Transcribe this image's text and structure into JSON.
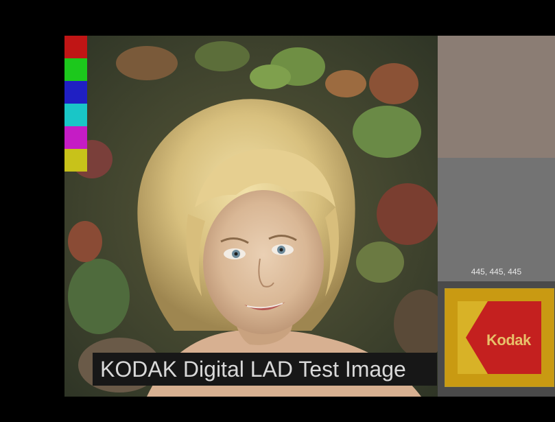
{
  "caption": "KODAK Digital LAD Test Image",
  "patch_readout": "445, 445, 445",
  "logo": {
    "wordmark": "Kodak",
    "colors": {
      "gold": "#c99a12",
      "red": "#c4201f",
      "yellow": "#d8b227"
    }
  },
  "swatches": [
    {
      "name": "red",
      "color": "#c01515"
    },
    {
      "name": "green",
      "color": "#1cc81c"
    },
    {
      "name": "blue",
      "color": "#1f1fc3"
    },
    {
      "name": "cyan",
      "color": "#19c6c7"
    },
    {
      "name": "magenta",
      "color": "#c51cc5"
    },
    {
      "name": "yellow",
      "color": "#c8c21a"
    }
  ],
  "patches": {
    "top_color": "#8b7d74",
    "bottom_color": "#737373"
  }
}
